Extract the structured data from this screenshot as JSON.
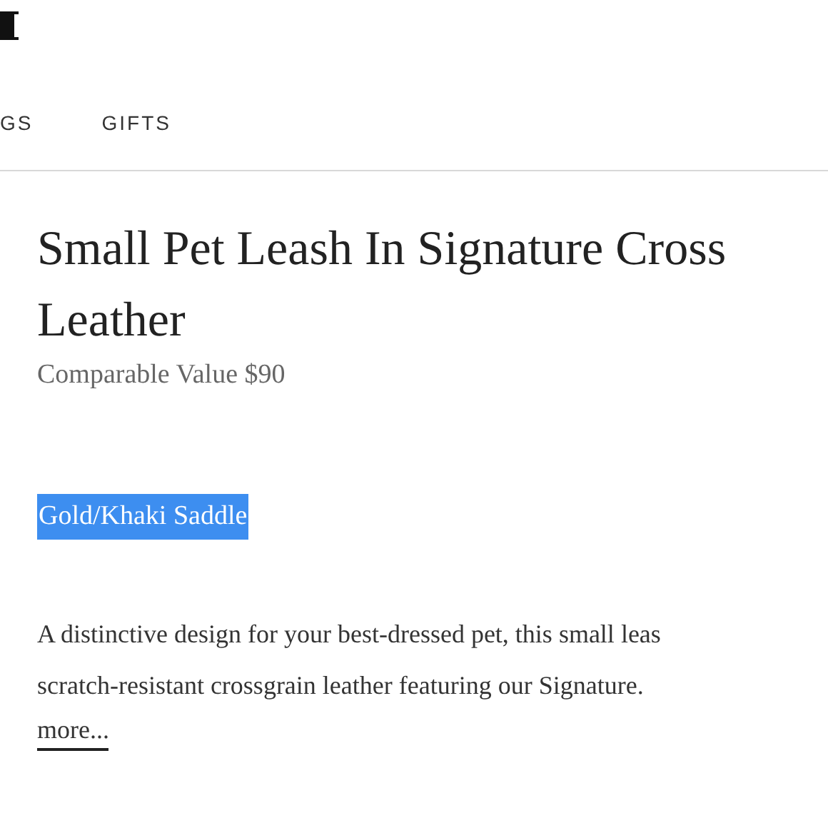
{
  "nav": {
    "items": [
      {
        "label": "GS"
      },
      {
        "label": "GIFTS"
      }
    ]
  },
  "product": {
    "title_lines": [
      "Small Pet Leash In Signature Cross",
      "Leather"
    ],
    "price": "Comparable Value $90",
    "color": {
      "label": "Gold/Khaki Saddle",
      "selected": true
    },
    "description_lines": [
      "A distinctive design for your best-dressed pet, this small leas",
      "scratch-resistant crossgrain leather featuring our Signature."
    ],
    "more_link": "more..."
  }
}
